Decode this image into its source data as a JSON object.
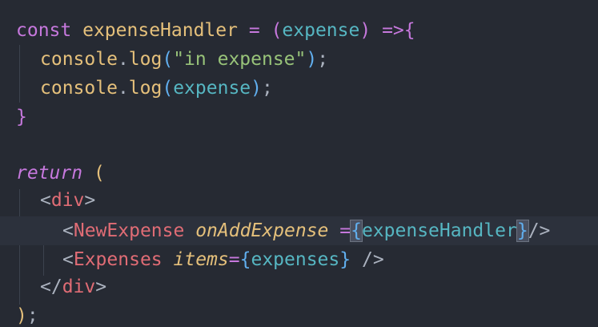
{
  "editor": {
    "lines": [
      {
        "tokens": [
          {
            "text": "const",
            "cls": "t-kw"
          },
          {
            "text": " ",
            "cls": "t-punct"
          },
          {
            "text": "expenseHandler",
            "cls": "t-ident"
          },
          {
            "text": " ",
            "cls": "t-punct"
          },
          {
            "text": "=",
            "cls": "t-op"
          },
          {
            "text": " ",
            "cls": "t-punct"
          },
          {
            "text": "(",
            "cls": "t-paren"
          },
          {
            "text": "expense",
            "cls": "t-param"
          },
          {
            "text": ")",
            "cls": "t-paren"
          },
          {
            "text": " ",
            "cls": "t-punct"
          },
          {
            "text": "=>",
            "cls": "t-op"
          },
          {
            "text": "{",
            "cls": "t-brace-outer"
          }
        ]
      },
      {
        "tokens": [
          {
            "text": "console",
            "cls": "t-obj"
          },
          {
            "text": ".",
            "cls": "t-punct"
          },
          {
            "text": "log",
            "cls": "t-method"
          },
          {
            "text": "(",
            "cls": "t-paren2"
          },
          {
            "text": "\"in expense\"",
            "cls": "t-str"
          },
          {
            "text": ")",
            "cls": "t-paren2"
          },
          {
            "text": ";",
            "cls": "t-punct"
          }
        ]
      },
      {
        "tokens": [
          {
            "text": "console",
            "cls": "t-obj"
          },
          {
            "text": ".",
            "cls": "t-punct"
          },
          {
            "text": "log",
            "cls": "t-method"
          },
          {
            "text": "(",
            "cls": "t-paren2"
          },
          {
            "text": "expense",
            "cls": "t-param"
          },
          {
            "text": ")",
            "cls": "t-paren2"
          },
          {
            "text": ";",
            "cls": "t-punct"
          }
        ]
      },
      {
        "tokens": [
          {
            "text": "}",
            "cls": "t-brace-outer"
          }
        ]
      },
      {
        "tokens": []
      },
      {
        "tokens": [
          {
            "text": "return",
            "cls": "t-ret"
          },
          {
            "text": " ",
            "cls": "t-punct"
          },
          {
            "text": "(",
            "cls": "t-fn"
          }
        ]
      },
      {
        "tokens": [
          {
            "text": "<",
            "cls": "t-punct"
          },
          {
            "text": "div",
            "cls": "t-tag"
          },
          {
            "text": ">",
            "cls": "t-punct"
          }
        ]
      },
      {
        "tokens": [
          {
            "text": "<",
            "cls": "t-punct"
          },
          {
            "text": "NewExpense",
            "cls": "t-tag"
          },
          {
            "text": " ",
            "cls": "t-punct"
          },
          {
            "text": "onAddExpense",
            "cls": "t-attr"
          },
          {
            "text": " ",
            "cls": "t-punct"
          },
          {
            "text": "=",
            "cls": "t-op"
          },
          {
            "text": "{",
            "cls": "t-jsx-brace",
            "match": true
          },
          {
            "text": "expenseHandler",
            "cls": "t-jsx-expr"
          },
          {
            "text": "}",
            "cls": "t-jsx-brace",
            "match": true
          },
          {
            "text": "/>",
            "cls": "t-punct"
          }
        ]
      },
      {
        "tokens": [
          {
            "text": "<",
            "cls": "t-punct"
          },
          {
            "text": "Expenses",
            "cls": "t-tag"
          },
          {
            "text": " ",
            "cls": "t-punct"
          },
          {
            "text": "items",
            "cls": "t-attr"
          },
          {
            "text": "=",
            "cls": "t-op"
          },
          {
            "text": "{",
            "cls": "t-jsx-brace"
          },
          {
            "text": "expenses",
            "cls": "t-jsx-expr"
          },
          {
            "text": "}",
            "cls": "t-jsx-brace"
          },
          {
            "text": " ",
            "cls": "t-punct"
          },
          {
            "text": "/>",
            "cls": "t-punct"
          }
        ]
      },
      {
        "tokens": [
          {
            "text": "</",
            "cls": "t-punct"
          },
          {
            "text": "div",
            "cls": "t-tag"
          },
          {
            "text": ">",
            "cls": "t-punct"
          }
        ]
      },
      {
        "tokens": [
          {
            "text": ")",
            "cls": "t-fn"
          },
          {
            "text": ";",
            "cls": "t-punct"
          }
        ]
      }
    ],
    "active_line": 7
  }
}
